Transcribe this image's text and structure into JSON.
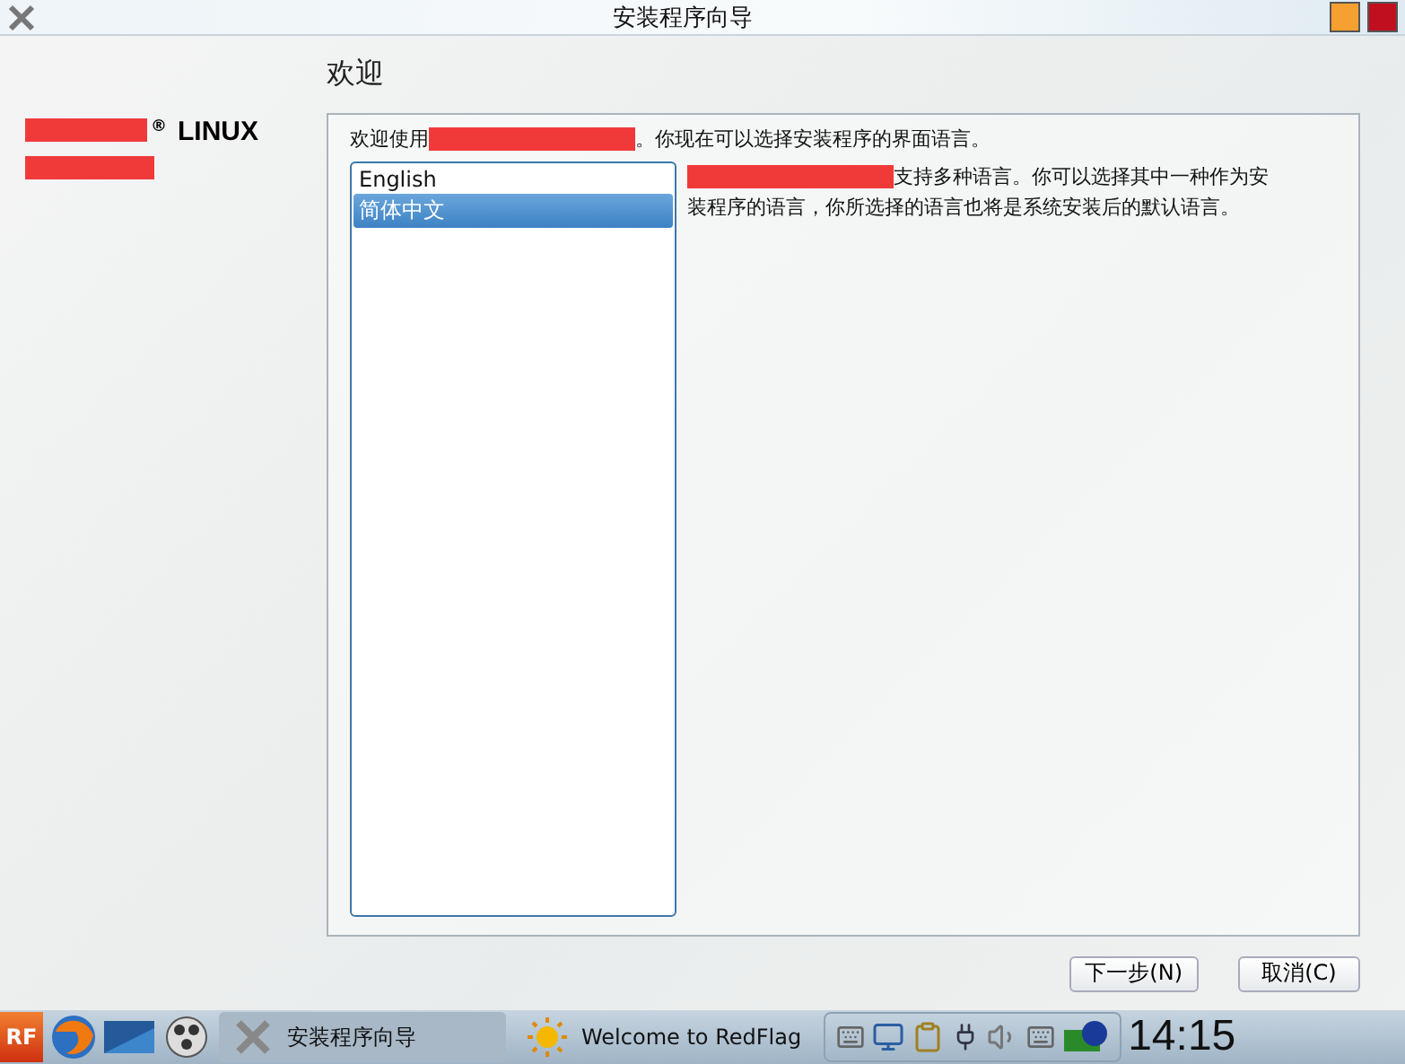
{
  "window": {
    "title": "安装程序向导"
  },
  "sidebar": {
    "logo_mark": "®",
    "logo_text": "LINUX"
  },
  "page": {
    "heading": "欢迎",
    "intro_before": "欢迎使用",
    "intro_after": "。你现在可以选择安装程序的界面语言。",
    "description_lines": [
      "支持多种语言。你可以选择其中一种作为安",
      "装程序的语言，你所选择的语言也将是系统安装后的默认语言。"
    ]
  },
  "languages": [
    {
      "label": "English",
      "selected": false
    },
    {
      "label": "简体中文",
      "selected": true
    }
  ],
  "buttons": [
    {
      "label": "下一步(N)"
    },
    {
      "label": "取消(C)"
    }
  ],
  "taskbar": {
    "start": "RF",
    "tasks": [
      {
        "label": "安装程序向导",
        "selected": true
      },
      {
        "label": "Welcome to RedFlag",
        "selected": false
      }
    ],
    "clock": "14:15"
  }
}
